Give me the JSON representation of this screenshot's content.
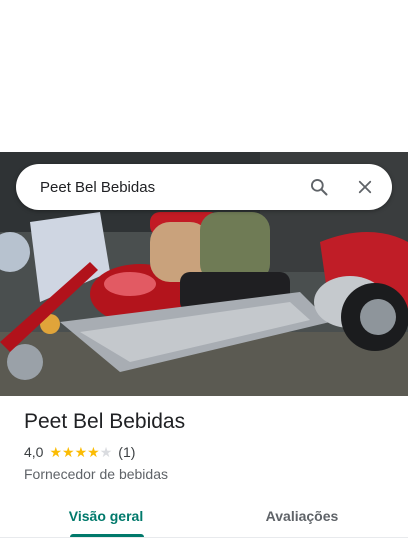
{
  "search": {
    "query": "Peet Bel Bebidas"
  },
  "icons": {
    "search": "search-icon",
    "close": "close-icon"
  },
  "hero": {
    "description_icon": "photo"
  },
  "place": {
    "name": "Peet Bel Bebidas",
    "rating": "4,0",
    "stars_filled": 4,
    "stars_total": 5,
    "review_count": "(1)",
    "category": "Fornecedor de bebidas"
  },
  "tabs": [
    {
      "label": "Visão geral",
      "active": true
    },
    {
      "label": "Avaliações",
      "active": false
    }
  ],
  "colors": {
    "accent": "#00796b",
    "star": "#fbbc04",
    "star_empty": "#dadce0"
  }
}
